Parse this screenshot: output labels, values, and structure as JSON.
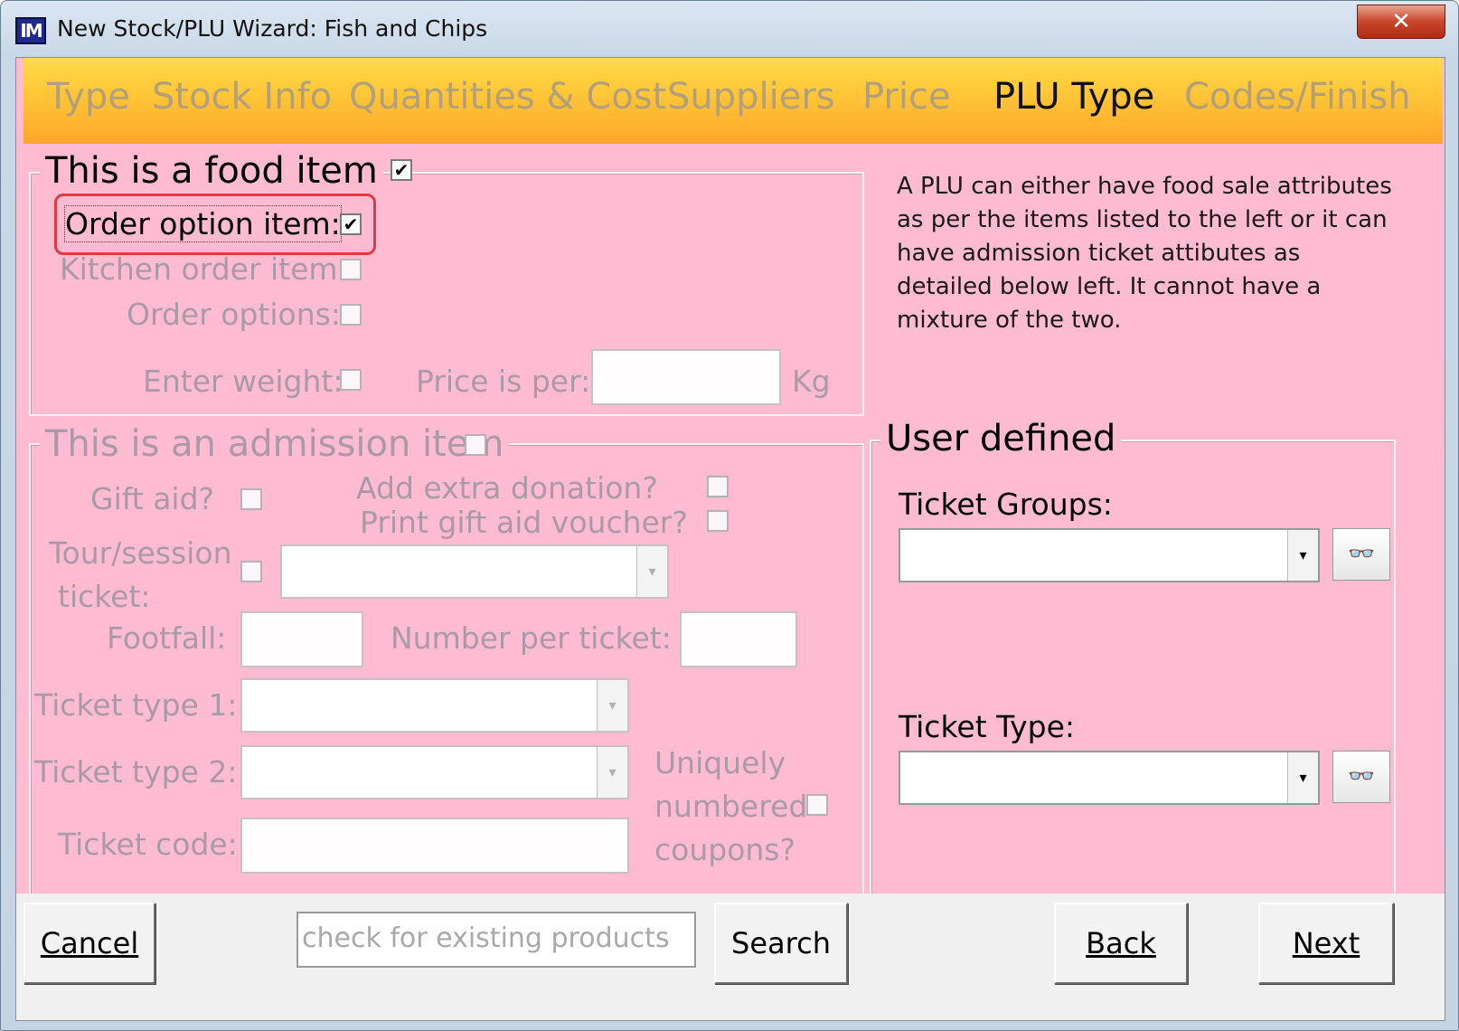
{
  "window": {
    "title": "New Stock/PLU Wizard: Fish and Chips",
    "app_icon_text": "IM",
    "close_glyph": "✕"
  },
  "steps": [
    "Type",
    "Stock Info",
    "Quantities & Cost",
    "Suppliers",
    "Price",
    "PLU Type",
    "Codes/Finish"
  ],
  "active_step": "PLU Type",
  "food": {
    "legend": "This is a food item",
    "checked": true,
    "order_option_label": "Order option item:",
    "order_option_checked": true,
    "kitchen_order_label": "Kitchen order item:",
    "order_options_label": "Order options:",
    "enter_weight_label": "Enter weight:",
    "price_per_label": "Price is per:",
    "price_per_value": "",
    "unit_label": "Kg"
  },
  "info_text": "A PLU can either have food sale attributes as per the items listed to the left or it can have admission  ticket attibutes as detailed below left.  It cannot have a mixture of the two.",
  "admission": {
    "legend": "This is an admission item",
    "gift_aid_label": "Gift aid?",
    "add_donation_label": "Add extra donation?",
    "print_voucher_label": "Print gift aid voucher?",
    "tour_label_line1": "Tour/session",
    "tour_label_line2": "ticket:",
    "footfall_label": "Footfall:",
    "number_per_ticket_label": "Number per ticket:",
    "ticket_type1_label": "Ticket type 1:",
    "ticket_type2_label": "Ticket type 2:",
    "ticket_code_label": "Ticket code:",
    "uniquely_line1": "Uniquely",
    "uniquely_line2": "numbered",
    "uniquely_line3": "coupons?"
  },
  "user_defined": {
    "legend": "User defined",
    "ticket_groups_label": "Ticket Groups:",
    "ticket_type_label": "Ticket Type:",
    "lookup_icon": "binoculars-icon"
  },
  "footer": {
    "cancel": "Cancel",
    "search_placeholder": "check for existing products",
    "search": "Search",
    "back": "Back",
    "next": "Next"
  },
  "colors": {
    "panel_bg": "#ffbbd1",
    "header_gradient_top": "#ffdb4a",
    "header_gradient_bottom": "#ffa62a",
    "highlight": "#e23a3a",
    "disabled_text": "#a99aa5"
  }
}
